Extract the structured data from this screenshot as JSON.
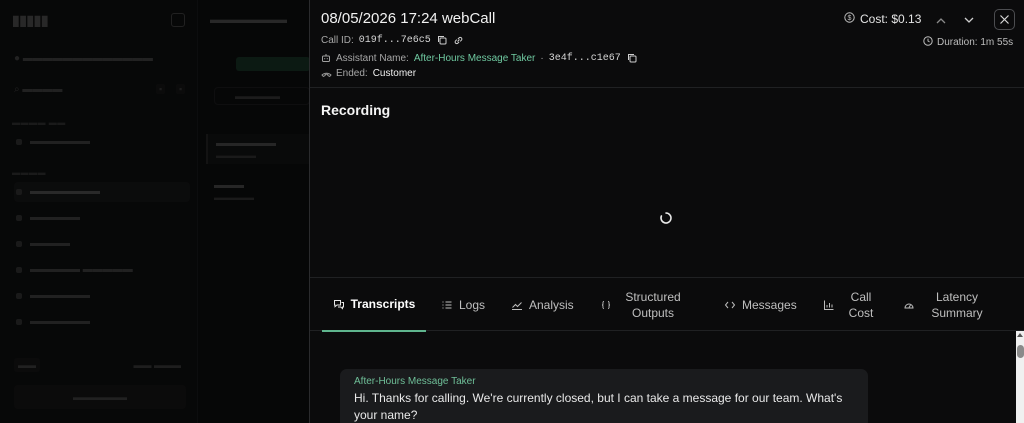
{
  "header": {
    "title": "08/05/2026 17:24 webCall",
    "call_id_label": "Call ID:",
    "call_id": "019f...7e6c5",
    "assistant_label": "Assistant Name:",
    "assistant_name": "After-Hours Message Taker",
    "assistant_sep": "·",
    "assistant_id": "3e4f...c1e67",
    "ended_label": "Ended:",
    "ended_value": "Customer",
    "cost": "Cost: $0.13",
    "duration": "Duration: 1m 55s"
  },
  "recording": {
    "title": "Recording"
  },
  "tabs": [
    {
      "label": "Transcripts",
      "icon": "chat-icon"
    },
    {
      "label": "Logs",
      "icon": "list-icon"
    },
    {
      "label": "Analysis",
      "icon": "trend-icon"
    },
    {
      "label": "Structured Outputs",
      "icon": "braces-icon"
    },
    {
      "label": "Messages",
      "icon": "code-icon"
    },
    {
      "label": "Call Cost",
      "icon": "bar-chart-icon"
    },
    {
      "label": "Latency Summary",
      "icon": "gauge-icon"
    }
  ],
  "transcript": [
    {
      "speaker": "After-Hours Message Taker",
      "text": "Hi. Thanks for calling. We're currently closed, but I can take a message for our team. What's your name?"
    }
  ],
  "colors": {
    "accent": "#5fb58e",
    "assistant_link": "#6fc9a0"
  }
}
